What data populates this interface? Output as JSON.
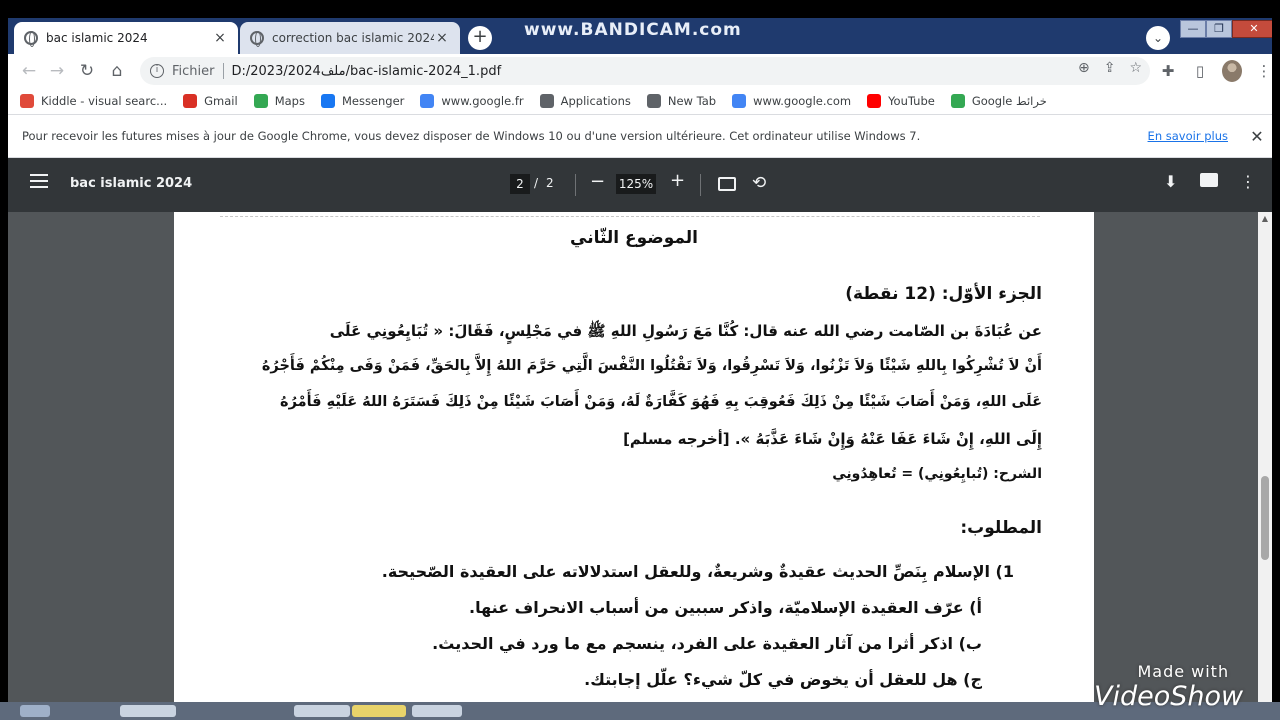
{
  "watermarks": {
    "top": "www.BANDICAM.com",
    "bottom_small": "Made with",
    "bottom_brand": "VideoShow"
  },
  "tabs": [
    {
      "title": "bac islamic 2024",
      "close": "×"
    },
    {
      "title": "correction bac islamic 2024",
      "close": "×"
    }
  ],
  "newtab_label": "+",
  "window_controls": {
    "tabsearch": "⌄",
    "min": "—",
    "max": "❐",
    "close": "✕"
  },
  "omnibox": {
    "scheme": "Fichier",
    "url": "D:/2023/2024ملف/bac-islamic-2024_1.pdf"
  },
  "nav": {
    "back": "←",
    "forward": "→",
    "reload": "↻",
    "home": "⌂"
  },
  "bookmarks": [
    {
      "label": "Kiddle - visual searc...",
      "icon": "kiddle-icon",
      "color": "#e04a3a"
    },
    {
      "label": "Gmail",
      "icon": "gmail-icon",
      "color": "#d93025"
    },
    {
      "label": "Maps",
      "icon": "maps-pin-icon",
      "color": "#34a853"
    },
    {
      "label": "Messenger",
      "icon": "facebook-icon",
      "color": "#1877f2"
    },
    {
      "label": "www.google.fr",
      "icon": "google-icon",
      "color": "#4285f4"
    },
    {
      "label": "Applications",
      "icon": "apps-grid-icon",
      "color": "#5f6368"
    },
    {
      "label": "New Tab",
      "icon": "globe-icon",
      "color": "#5f6368"
    },
    {
      "label": "www.google.com",
      "icon": "google-icon",
      "color": "#4285f4"
    },
    {
      "label": "YouTube",
      "icon": "youtube-icon",
      "color": "#ff0000"
    },
    {
      "label": "Google خرائط",
      "icon": "maps-pin-icon",
      "color": "#34a853"
    }
  ],
  "infobar": {
    "message": "Pour recevoir les futures mises à jour de Google Chrome, vous devez disposer de Windows 10 ou d'une version ultérieure. Cet ordinateur utilise Windows 7.",
    "link": "En savoir plus",
    "close": "✕"
  },
  "pdf": {
    "title": "bac islamic 2024",
    "page": "2",
    "separator": "/",
    "total": "2",
    "zoom": "125%",
    "minus": "−",
    "plus": "+"
  },
  "document": {
    "heading": "الموضوع الثّاني",
    "part_title": "الجزء الأوّل: (12 نقطة)",
    "hadith_lines": [
      "عن عُبَادَةَ بن الصّامت رضي الله عنه قال: كُنَّا مَعَ رَسُولِ اللهِ ﷺ في مَجْلِسٍ، فَقَالَ: « تُبَايِعُونِي عَلَى",
      "أَنْ لاَ تُشْرِكُوا بِاللهِ شَيْئًا وَلاَ تَزْنُوا، وَلاَ تَسْرِقُوا، وَلاَ تَقْتُلُوا النَّفْسَ الَّتِي حَرَّمَ اللهُ إِلاَّ بِالحَقِّ، فَمَنْ وَفَى مِنْكُمْ فَأَجْرُهُ",
      "عَلَى اللهِ، وَمَنْ أَصَابَ شَيْئًا مِنْ ذَلِكَ فَعُوقِبَ بِهِ فَهُوَ كَفَّارَةٌ لَهُ، وَمَنْ أَصَابَ شَيْئًا مِنْ ذَلِكَ فَسَتَرَهُ اللهُ عَلَيْهِ فَأَمْرُهُ",
      "إِلَى اللهِ، إِنْ شَاءَ عَفَا عَنْهُ وَإِنْ شَاءَ عَذَّبَهُ ». [أخرجه مسلم]"
    ],
    "explanation": "الشرح: (تُبايِعُونِي) = تُعاهِدُونِي",
    "required_title": "المطلوب:",
    "q1": "1) الإسلام بِنَصِّ الحديث عقيدةٌ وشريعةٌ، وللعقل استدلالاته على العقيدة الصّحيحة.",
    "q1a": "أ) عرّف العقيدة الإسلاميّة، واذكر سببين من أسباب الانحراف عنها.",
    "q1b": "ب) اذكر أثرا من آثار العقيدة على الفرد، ينسجم مع ما ورد في الحديث.",
    "q1c": "ج) هل للعقل أن يخوض في كلّ شيء؟ علّل إجابتك."
  }
}
